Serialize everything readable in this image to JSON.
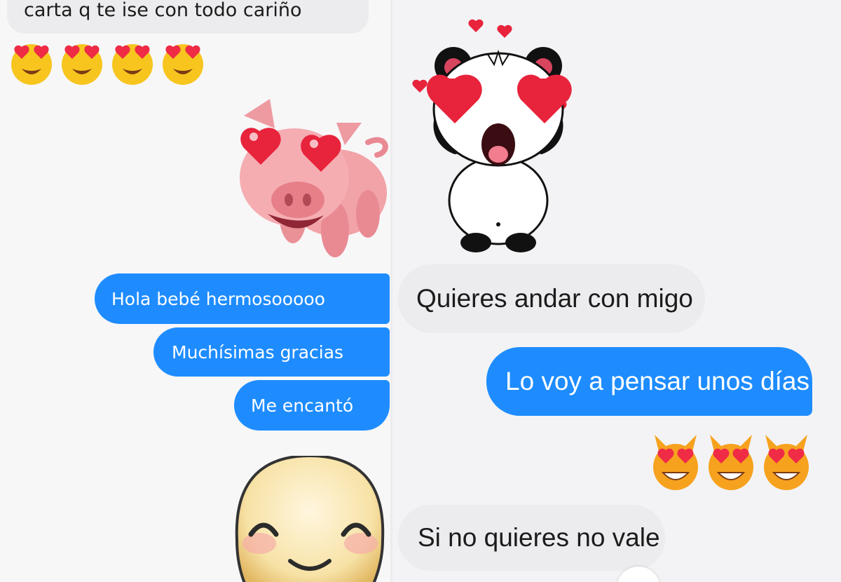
{
  "left_chat": {
    "truncated_message": "carta q te ise con todo cariño",
    "reaction_emojis": [
      "heart-eyes-face-icon",
      "heart-eyes-face-icon",
      "heart-eyes-face-icon",
      "heart-eyes-face-icon"
    ],
    "sticker": "pig-heart-eyes-sticker",
    "messages_out": [
      "Hola bebé hermosooooo",
      "Muchísimas gracias",
      "Me encantó"
    ],
    "bottom_sticker": "smiling-face-sticker"
  },
  "right_chat": {
    "sticker": "panda-heart-eyes-sticker",
    "message_in_1": "Quieres andar con migo",
    "message_out_1": "Lo voy a pensar unos días",
    "reaction_emojis": [
      "heart-eyes-cat-icon",
      "heart-eyes-cat-icon",
      "heart-eyes-cat-icon"
    ],
    "message_in_2": "Si no quieres no vale"
  },
  "colors": {
    "outgoing_bubble": "#1e8cff",
    "incoming_bubble": "#ececee",
    "background": "#f5f5f7"
  }
}
